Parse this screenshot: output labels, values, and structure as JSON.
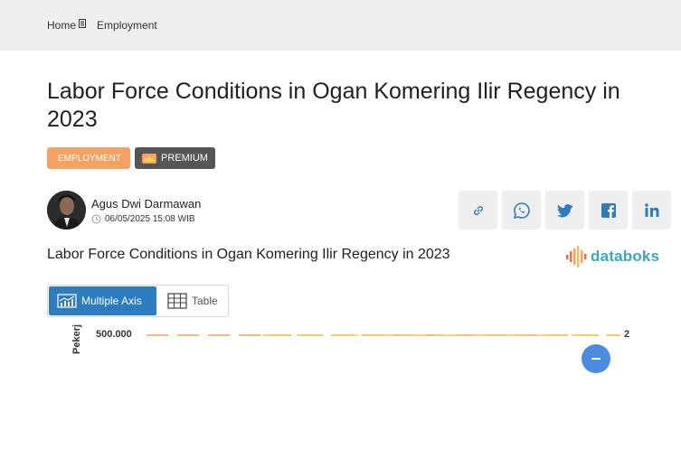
{
  "breadcrumb": {
    "home": "Home",
    "current": "Employment"
  },
  "article": {
    "title": "Labor Force Conditions in Ogan Komering Ilir Regency in 2023",
    "category": "EMPLOYMENT",
    "premium_label": "PREMIUM",
    "author": "Agus Dwi Darmawan",
    "date": "06/05/2025 15:08 WIB"
  },
  "share_icons": [
    "link-icon",
    "whatsapp-icon",
    "twitter-icon",
    "facebook-icon",
    "linkedin-icon"
  ],
  "chart_panel": {
    "title": "Labor Force Conditions in Ogan Komering Ilir Regency in 2023",
    "brand": "databoks",
    "tabs": {
      "multiple_axis": "Multiple Axis",
      "table": "Table"
    }
  },
  "chart_data": {
    "type": "line",
    "ylabel": "Pekerj",
    "yticks": [
      "500.000"
    ],
    "right_axis_label": "2",
    "series_colors": [
      "#f4a261",
      "#f7c948"
    ]
  },
  "colors": {
    "accent": "#2e7cc0",
    "category_badge": "#f4a261",
    "premium_badge": "#555555",
    "brand": "#3aa6c7"
  }
}
